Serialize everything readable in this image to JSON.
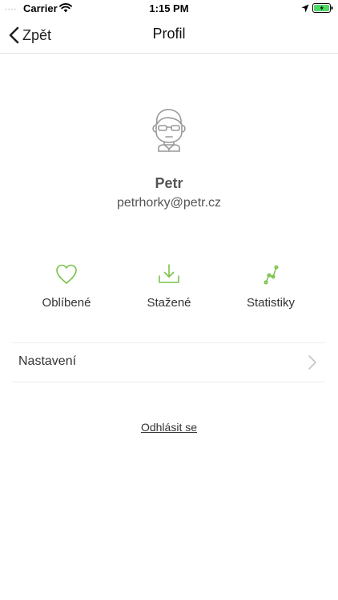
{
  "status_bar": {
    "signal": "....",
    "carrier": "Carrier",
    "time": "1:15 PM"
  },
  "nav": {
    "back_label": "Zpět",
    "title": "Profil"
  },
  "user": {
    "name": "Petr",
    "email": "petrhorky@petr.cz"
  },
  "actions": [
    {
      "label": "Oblíbené",
      "icon": "heart-icon"
    },
    {
      "label": "Stažené",
      "icon": "download-icon"
    },
    {
      "label": "Statistiky",
      "icon": "stats-icon"
    }
  ],
  "settings": {
    "label": "Nastavení"
  },
  "logout": {
    "label": "Odhlásit se"
  },
  "colors": {
    "accent": "#7cc24a",
    "battery": "#4cd964",
    "divider": "#e2e2e2"
  }
}
